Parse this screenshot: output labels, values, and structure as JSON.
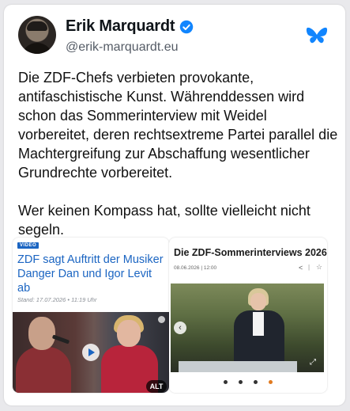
{
  "post": {
    "author_name": "Erik Marquardt",
    "author_handle": "@erik-marquardt.eu",
    "verified_icon": "verified-check-icon",
    "platform_icon": "bluesky-butterfly-icon",
    "paragraphs": [
      "Die ZDF-Chefs verbieten provokante, antifaschistische Kunst. Währenddessen wird schon das Sommerinterview mit Weidel vorbereitet, deren rechtsextreme Partei parallel die Machtergreifung zur Abschaffung wesentlicher Grundrechte vorbereitet.",
      "Wer keinen Kompass hat, sollte vielleicht nicht segeln."
    ],
    "alt_badge": "ALT"
  },
  "left_article": {
    "badge": "VIDEO",
    "title": "ZDF sagt Auftritt der Musiker Danger Dan und Igor Levit ab",
    "date": "Stand: 17.07.2026 • 11:19 Uhr"
  },
  "right_article": {
    "title": "Die ZDF-Sommerinterviews 2026",
    "meta": "08.06.2026 | 12:00",
    "share_glyph": "<",
    "separator": "|",
    "star_glyph": "☆",
    "arrow_glyph": "‹",
    "expand_glyph": "⤢",
    "carousel_dots": 4,
    "active_dot": 3
  },
  "colors": {
    "accent_blue": "#1b65c2",
    "bluesky_blue": "#1185fe",
    "active_dot": "#e07a20"
  }
}
